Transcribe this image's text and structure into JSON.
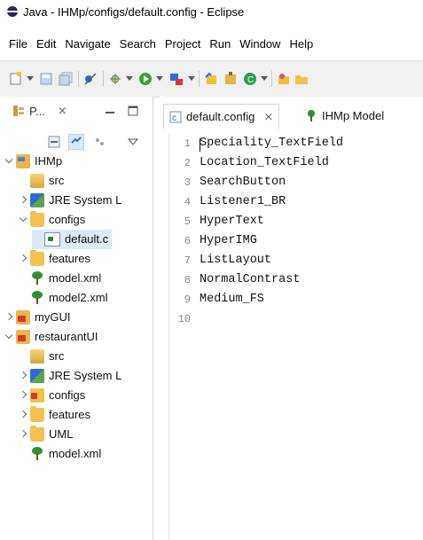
{
  "window": {
    "title": "Java - IHMp/configs/default.config - Eclipse"
  },
  "menu": [
    "File",
    "Edit",
    "Navigate",
    "Search",
    "Project",
    "Run",
    "Window",
    "Help"
  ],
  "left_view": {
    "tab_label": "P...",
    "close_label": "⨯"
  },
  "tree": [
    {
      "label": "IHMp",
      "level": 0,
      "expanded": true,
      "icon": "project-icon"
    },
    {
      "label": "src",
      "level": 1,
      "icon": "package-folder-icon"
    },
    {
      "label": "JRE System L",
      "level": 1,
      "collapsed": true,
      "icon": "jre-library-icon"
    },
    {
      "label": "configs",
      "level": 1,
      "expanded": true,
      "icon": "folder-icon"
    },
    {
      "label": "default.c",
      "level": 2,
      "selected": true,
      "icon": "config-file-icon"
    },
    {
      "label": "features",
      "level": 1,
      "collapsed": true,
      "icon": "folder-icon"
    },
    {
      "label": "model.xml",
      "level": 1,
      "icon": "tree-model-icon"
    },
    {
      "label": "model2.xml",
      "level": 1,
      "icon": "tree-model-icon"
    },
    {
      "label": "myGUI",
      "level": 0,
      "collapsed": true,
      "icon": "project-error-icon"
    },
    {
      "label": "restaurantUI",
      "level": 0,
      "expanded": true,
      "icon": "project-error-icon"
    },
    {
      "label": "src",
      "level": 1,
      "icon": "package-folder-icon"
    },
    {
      "label": "JRE System L",
      "level": 1,
      "collapsed": true,
      "icon": "jre-library-icon"
    },
    {
      "label": "configs",
      "level": 1,
      "collapsed": true,
      "icon": "folder-error-icon"
    },
    {
      "label": "features",
      "level": 1,
      "collapsed": true,
      "icon": "folder-icon"
    },
    {
      "label": "UML",
      "level": 1,
      "collapsed": true,
      "icon": "folder-icon"
    },
    {
      "label": "model.xml",
      "level": 1,
      "icon": "tree-model-icon"
    }
  ],
  "editor": {
    "tabs": [
      {
        "label": "default.config",
        "active": true,
        "close": "⨯"
      },
      {
        "label": "IHMp Model",
        "active": false
      }
    ],
    "lines": [
      "Speciality_TextField",
      "Location_TextField",
      "SearchButton",
      "Listener1_BR",
      "HyperText",
      "HyperIMG",
      "ListLayout",
      "NormalContrast",
      "Medium_FS",
      ""
    ],
    "line_numbers": [
      "1",
      "2",
      "3",
      "4",
      "5",
      "6",
      "7",
      "8",
      "9",
      "10"
    ]
  },
  "colors": {
    "toolbar_bg": "#f0f0f0",
    "selection_bg": "#dce9f7",
    "accent": "#2f6bd6"
  }
}
